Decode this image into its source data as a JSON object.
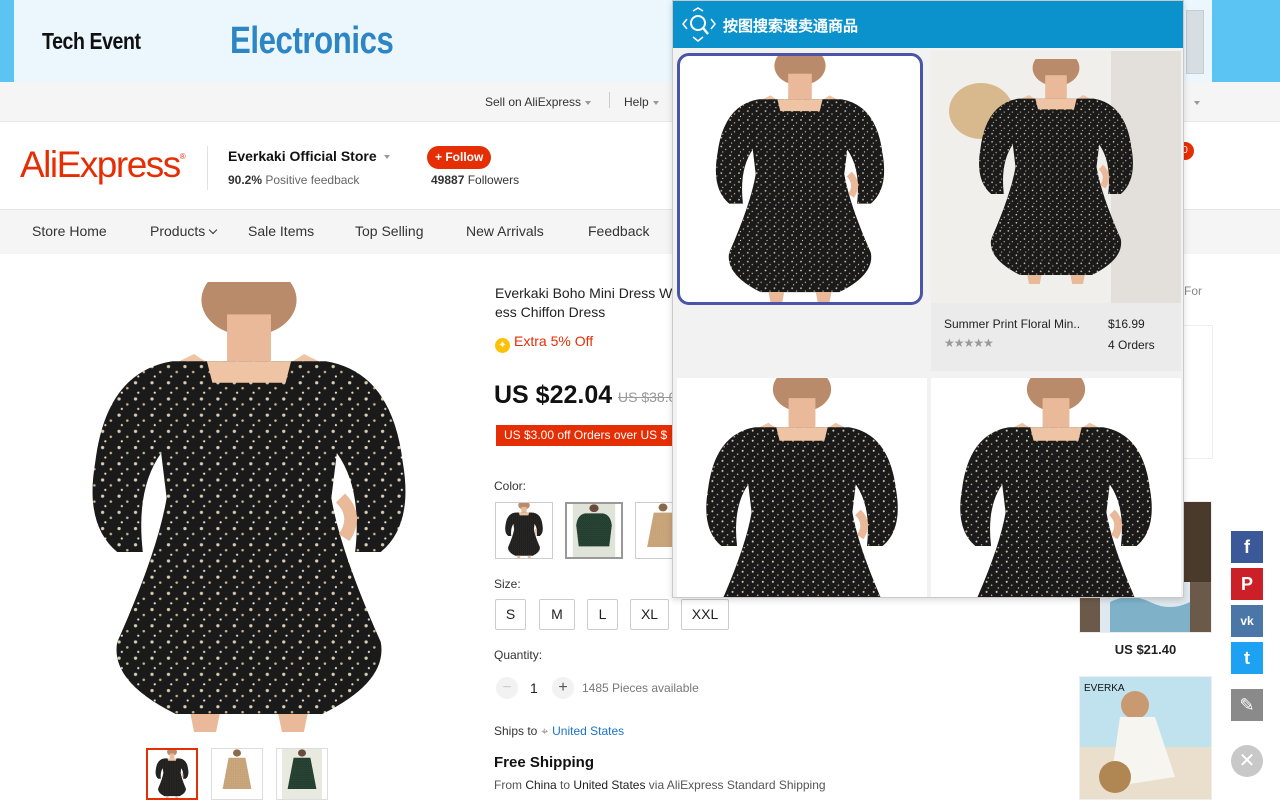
{
  "banner": {
    "left_text": "Tech Event",
    "right_text": "Electronics"
  },
  "topbar": {
    "sell": "Sell on AliExpress",
    "help": "Help"
  },
  "store": {
    "logo": "AliExpress",
    "name": "Everkaki Official Store",
    "feedback_pct": "90.2%",
    "feedback_label": "Positive feedback",
    "follow_label": "+ Follow",
    "followers_count": "49887",
    "followers_label": "Followers",
    "cart_count": "0"
  },
  "nav": {
    "items": [
      {
        "label": "Store Home"
      },
      {
        "label": "Products"
      },
      {
        "label": "Sale Items"
      },
      {
        "label": "Top Selling"
      },
      {
        "label": "New Arrivals"
      },
      {
        "label": "Feedback"
      }
    ]
  },
  "product": {
    "title_line1": "Everkaki Boho Mini Dress W",
    "title_line2": "ess Chiffon Dress",
    "extra_off": "Extra 5% Off",
    "price": "US $22.04",
    "old_price": "US $38.0",
    "coupon": "US $3.00 off Orders over US $",
    "color_label": "Color:",
    "size_label": "Size:",
    "sizes": [
      "S",
      "M",
      "L",
      "XL",
      "XXL"
    ],
    "quantity_label": "Quantity:",
    "quantity": "1",
    "minus": "−",
    "plus": "+",
    "available": "1485 Pieces available",
    "ships_to_label": "Ships to",
    "ships_to_country": "United States",
    "free_shipping": "Free Shipping",
    "ship_from_word": "From",
    "ship_from": "China",
    "ship_to_word": "to",
    "ship_to": "United States",
    "ship_via": "via AliExpress Standard Shipping"
  },
  "right": {
    "for_label": "For",
    "rec_price": "US $21.40",
    "rec_brand": "EVERKA"
  },
  "share": {
    "facebook": "f",
    "pinterest": "P",
    "vk": "vk",
    "twitter": "t",
    "edit": "✎",
    "close": "✕"
  },
  "popup": {
    "title": "按图搜索速卖通商品",
    "result": {
      "name": "Summer Print Floral Min..",
      "price": "$16.99",
      "stars": "★★★★★",
      "orders": "4 Orders"
    }
  },
  "colors": {
    "brand_red": "#e62e04",
    "popup_header": "#0b92cd",
    "link_blue": "#1a73c8"
  },
  "icons": [
    "search-image-icon",
    "facebook-icon",
    "pinterest-icon",
    "vk-icon",
    "twitter-icon",
    "edit-icon",
    "close-icon",
    "location-pin-icon",
    "coin-icon"
  ]
}
